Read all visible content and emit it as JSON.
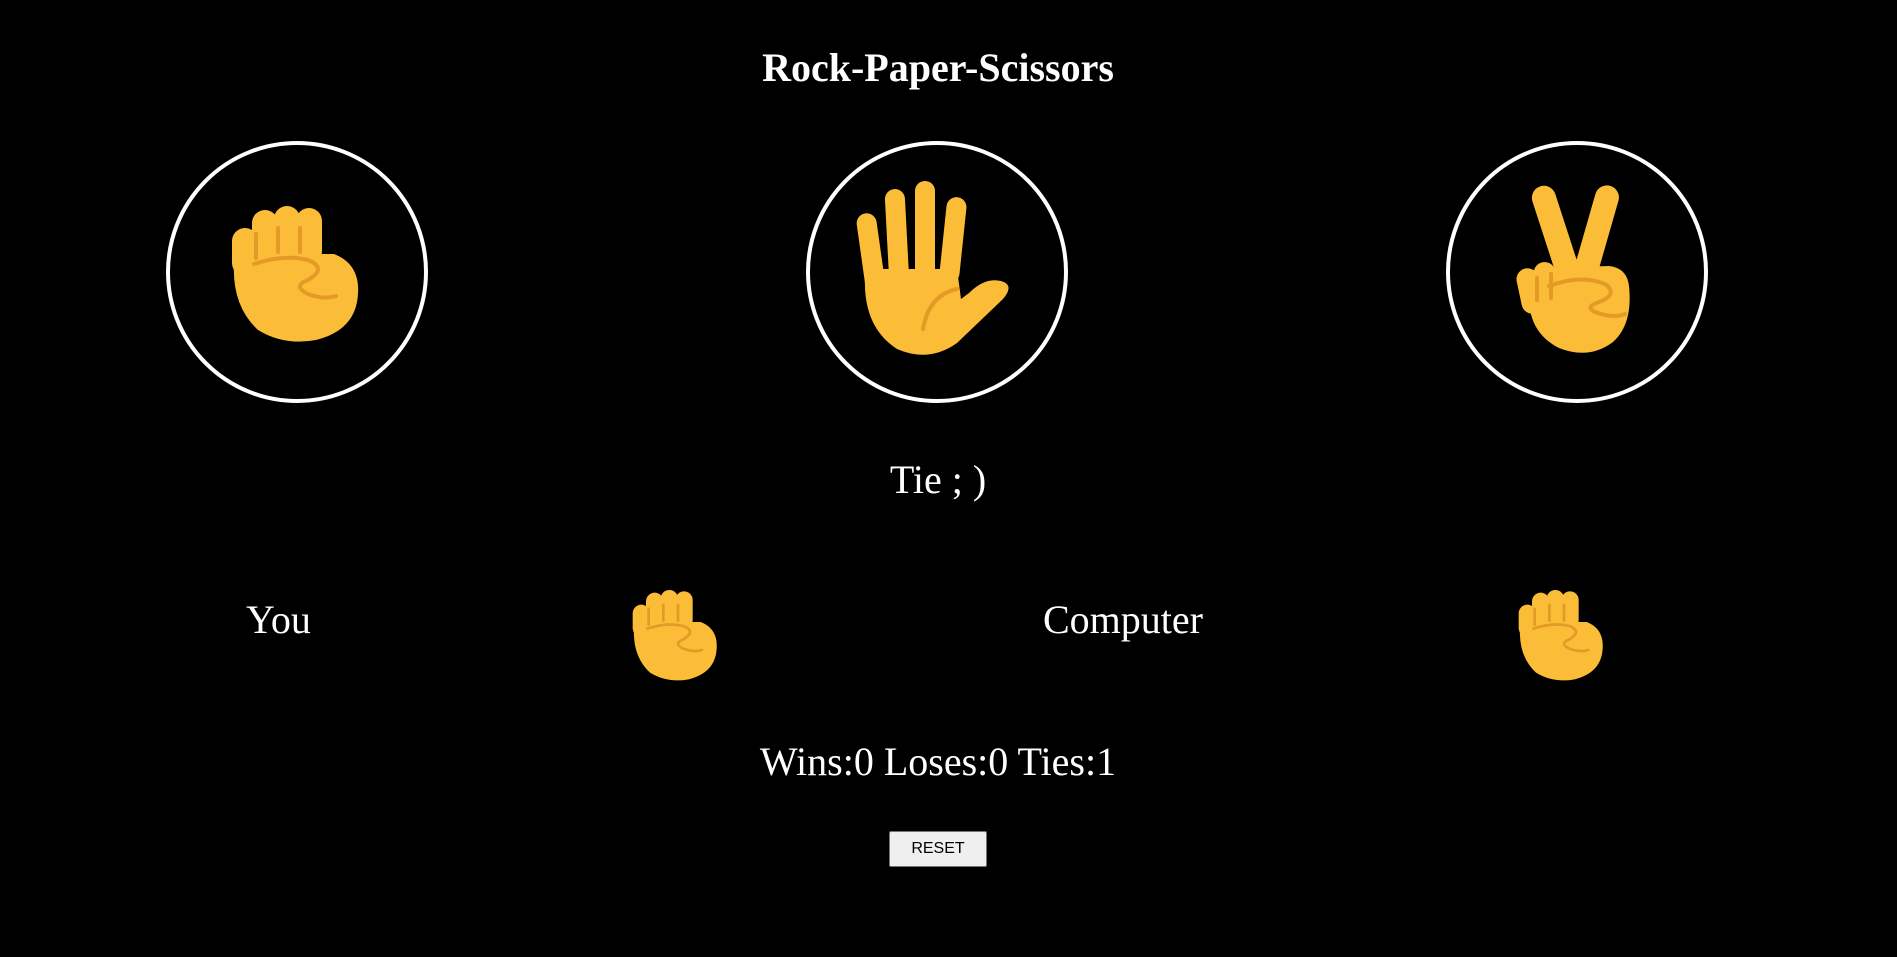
{
  "title": "Rock-Paper-Scissors",
  "choices": [
    {
      "id": "rock",
      "icon": "raised-fist-icon"
    },
    {
      "id": "paper",
      "icon": "raised-hand-icon"
    },
    {
      "id": "scissors",
      "icon": "victory-hand-icon"
    }
  ],
  "result": "Tie ; )",
  "player": {
    "label": "You",
    "pick_icon": "raised-fist-icon"
  },
  "computer": {
    "label": "Computer",
    "pick_icon": "raised-fist-icon"
  },
  "score": {
    "text": "Wins:0 Loses:0 Ties:1",
    "wins": 0,
    "loses": 0,
    "ties": 1
  },
  "reset_label": "RESET",
  "colors": {
    "background": "#000000",
    "text": "#ffffff",
    "emoji_skin": "#FBBD38",
    "emoji_line": "#E39A26",
    "button_bg": "#efefef"
  }
}
